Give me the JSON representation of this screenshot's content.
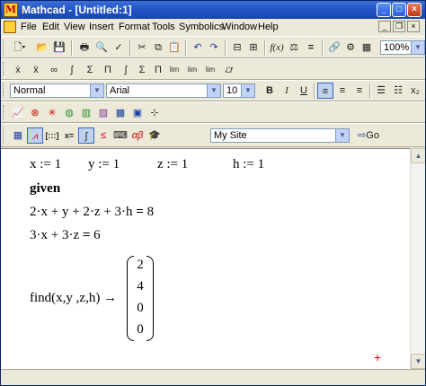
{
  "window": {
    "title": "Mathcad - [Untitled:1]",
    "controls": {
      "minimize": "_",
      "maximize": "□",
      "close": "×"
    }
  },
  "menu": [
    "File",
    "Edit",
    "View",
    "Insert",
    "Format",
    "Tools",
    "Symbolics",
    "Window",
    "Help"
  ],
  "standard_toolbar": {
    "zoom": "100%"
  },
  "formatting_toolbar": {
    "style": "Normal",
    "font": "Arial",
    "size": "10",
    "bold": "B",
    "italic": "I",
    "underline": "U"
  },
  "resources_toolbar": {
    "site": "My Site",
    "go_label": "Go"
  },
  "worksheet": {
    "definitions": [
      "x := 1",
      "y := 1",
      "z := 1",
      "h := 1"
    ],
    "given": "given",
    "constraint1_lhs": "2·x + y + 2·z + 3·h",
    "constraint1_eq": "=",
    "constraint1_rhs": "8",
    "constraint2_lhs": "3·x + 3·z",
    "constraint2_eq": "=",
    "constraint2_rhs": "6",
    "find_expr": "find(x,y ,z,h)",
    "arrow": "→",
    "result_vector": [
      "2",
      "4",
      "0",
      "0"
    ]
  },
  "icons": [
    "new-icon",
    "open-icon",
    "save-icon",
    "print-icon",
    "print-preview-icon",
    "spell-check-icon",
    "cut-icon",
    "copy-icon",
    "paste-icon",
    "undo-icon",
    "redo-icon",
    "align-across-icon",
    "align-down-icon",
    "insert-function-icon",
    "insert-unit-icon",
    "calculate-icon",
    "insert-hyperlink-icon",
    "component-wizard-icon",
    "run-script-icon",
    "resource-center-icon",
    "help-icon",
    "go-icon",
    "add-red-cross"
  ]
}
